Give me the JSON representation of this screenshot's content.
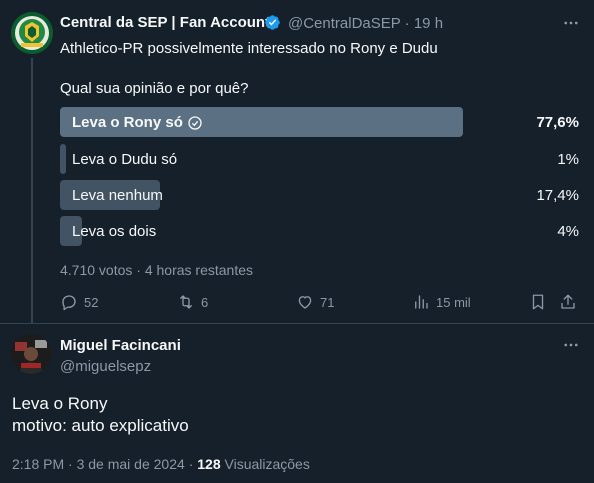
{
  "quoted_tweet": {
    "author_name": "Central da SEP | Fan Account",
    "handle": "@CentralDaSEP",
    "separator": "·",
    "time": "19 h",
    "line1": "Athletico-PR possivelmente interessado no Rony e Dudu",
    "line2": "Qual sua opinião e por quê?",
    "poll": {
      "options": [
        {
          "label": "Leva o Rony só",
          "percent": "77,6%",
          "value": 0.776,
          "winner": true
        },
        {
          "label": "Leva o Dudu só",
          "percent": "1%",
          "value": 0.01,
          "winner": false
        },
        {
          "label": "Leva nenhum",
          "percent": "17,4%",
          "value": 0.174,
          "winner": false
        },
        {
          "label": "Leva os dois",
          "percent": "4%",
          "value": 0.04,
          "winner": false
        }
      ],
      "votes": "4.710 votos",
      "dot": "·",
      "remaining": "4 horas restantes"
    },
    "actions": {
      "replies": "52",
      "retweets": "6",
      "likes": "71",
      "views": "15 mil"
    }
  },
  "reply_tweet": {
    "author_name": "Miguel Facincani",
    "handle": "@miguelsepz",
    "line1": "Leva o Rony",
    "line2": "motivo: auto explicativo",
    "time": "2:18 PM",
    "dot": "·",
    "date": "3 de mai de 2024",
    "dot2": "·",
    "views_count": "128",
    "views_label": "Visualizações"
  },
  "colors": {
    "background": "#15202b",
    "verified": "#1d9bf0",
    "poll_winner": "#5b7083",
    "poll_other": "#425364",
    "muted_text": "#8b98a5"
  }
}
